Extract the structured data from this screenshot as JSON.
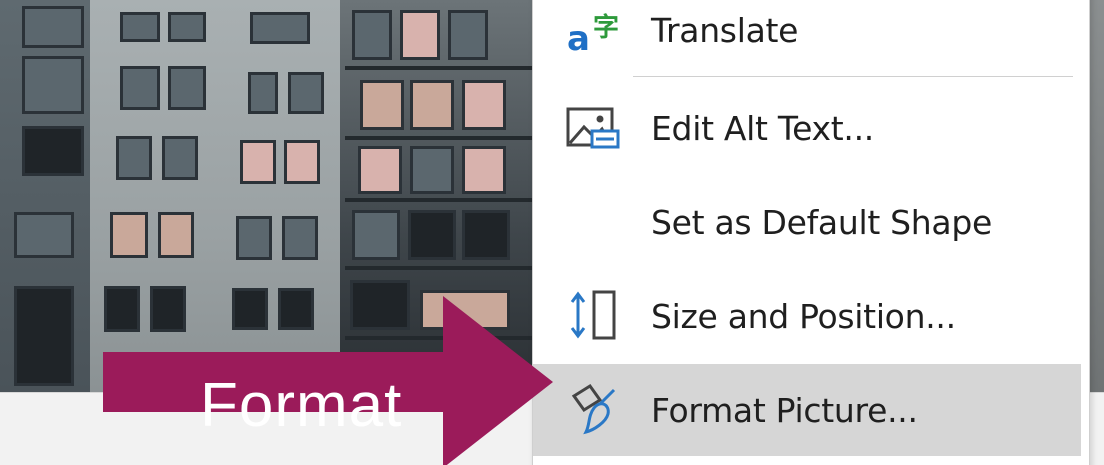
{
  "menu": {
    "items": [
      {
        "id": "translate",
        "label": "Translate",
        "icon": "translate-icon"
      },
      {
        "id": "edit-alt-text",
        "label": "Edit Alt Text...",
        "icon": "alt-text-icon"
      },
      {
        "id": "set-default-shape",
        "label": "Set as Default Shape",
        "icon": ""
      },
      {
        "id": "size-position",
        "label": "Size and Position...",
        "icon": "size-position-icon"
      },
      {
        "id": "format-picture",
        "label": "Format Picture...",
        "icon": "format-picture-icon",
        "highlighted": true
      }
    ]
  },
  "callout": {
    "text": "Format",
    "color": "#9b1b5a"
  },
  "colors": {
    "menu_hover": "#d6d6d6",
    "translate_blue": "#1f6fc5",
    "translate_green": "#2e9a3b",
    "icon_blue": "#2a78c6"
  }
}
